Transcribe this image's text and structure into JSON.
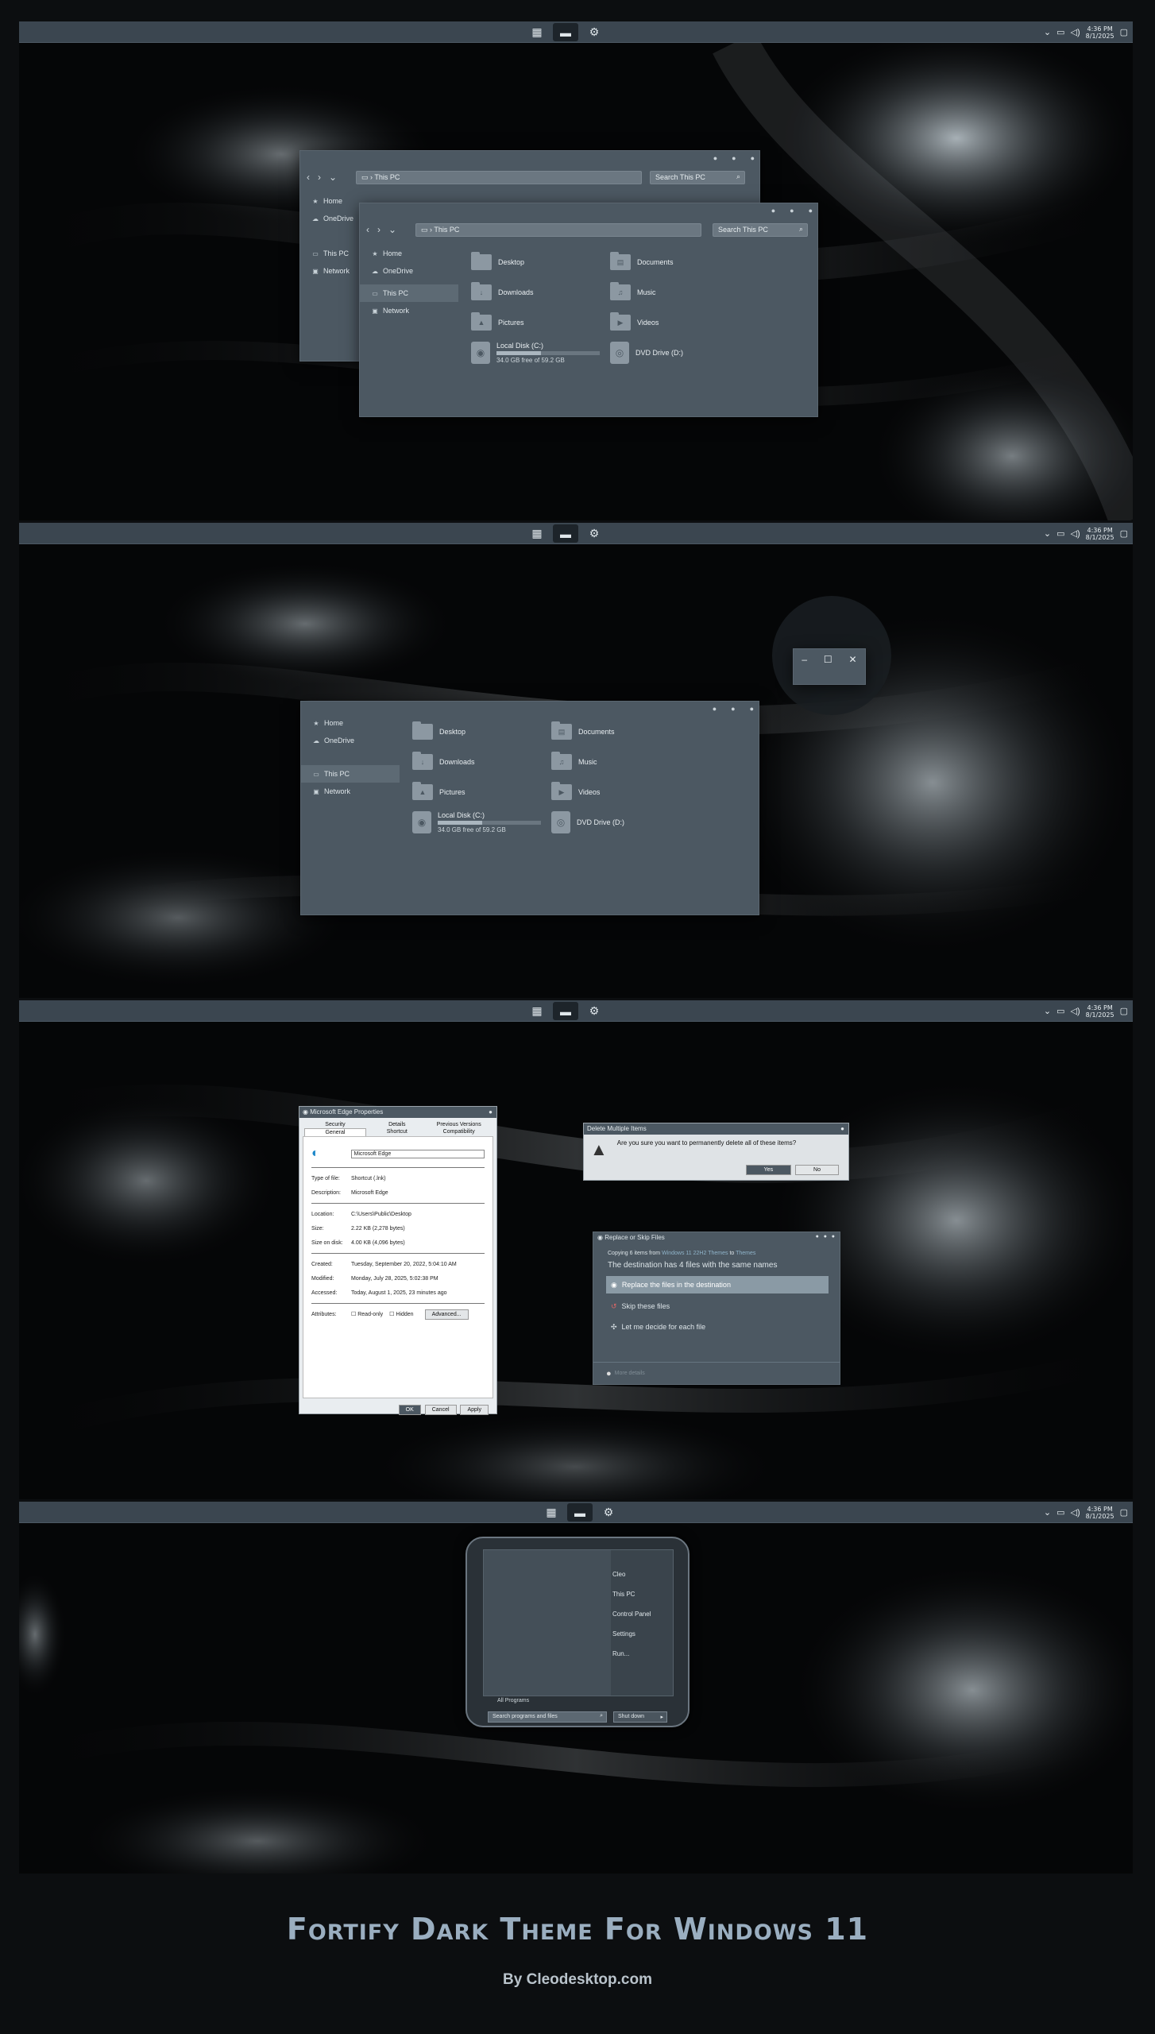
{
  "taskbar": {
    "clock_time": "4:36 PM",
    "clock_date": "8/1/2025",
    "start_icon": "start-grid-icon",
    "explorer_icon": "folder-icon",
    "settings_icon": "settings-icon"
  },
  "explorer": {
    "address": "This PC",
    "search_placeholder": "Search This PC",
    "sidebar": [
      "Home",
      "OneDrive",
      "This PC",
      "Network"
    ],
    "folders": [
      "Desktop",
      "Documents",
      "Downloads",
      "Music",
      "Pictures",
      "Videos"
    ],
    "local_disk": {
      "name": "Local Disk (C:)",
      "free": "34.0 GB free of 59.2 GB",
      "used_fraction": 0.43
    },
    "dvd": "DVD Drive (D:)"
  },
  "properties": {
    "title": "Microsoft Edge Properties",
    "tabs": [
      "Security",
      "Details",
      "Previous Versions",
      "General",
      "Shortcut",
      "Compatibility"
    ],
    "name": "Microsoft Edge",
    "rows": [
      {
        "k": "Type of file:",
        "v": "Shortcut (.lnk)"
      },
      {
        "k": "Description:",
        "v": "Microsoft Edge"
      },
      {
        "k": "Location:",
        "v": "C:\\Users\\Public\\Desktop"
      },
      {
        "k": "Size:",
        "v": "2.22 KB (2,278 bytes)"
      },
      {
        "k": "Size on disk:",
        "v": "4.00 KB (4,096 bytes)"
      },
      {
        "k": "Created:",
        "v": "Tuesday, September 20, 2022, 5:04:10 AM"
      },
      {
        "k": "Modified:",
        "v": "Monday, July 28, 2025, 5:02:38 PM"
      },
      {
        "k": "Accessed:",
        "v": "Today, August 1, 2025, 23 minutes ago"
      }
    ],
    "attributes_label": "Attributes:",
    "readonly": "Read-only",
    "hidden": "Hidden",
    "advanced": "Advanced...",
    "ok": "OK",
    "cancel": "Cancel",
    "apply": "Apply"
  },
  "delete_dialog": {
    "title": "Delete Multiple Items",
    "message": "Are you sure you want to permanently delete all of these items?",
    "yes": "Yes",
    "no": "No"
  },
  "replace_dialog": {
    "title": "Replace or Skip Files",
    "copying_pre": "Copying 6 items from",
    "copying_src": "Windows 11 22H2 Themes",
    "copying_mid": "to",
    "copying_dst": "Themes",
    "heading": "The destination has 4 files with the same names",
    "options": [
      "Replace the files in the destination",
      "Skip these files",
      "Let me decide for each file"
    ],
    "more": "More details"
  },
  "start_menu": {
    "links": [
      "Cleo",
      "This PC",
      "Control Panel",
      "Settings",
      "Run..."
    ],
    "all_programs": "All Programs",
    "search_placeholder": "Search programs and files",
    "shutdown": "Shut down"
  },
  "caption": {
    "title": "Fortify Dark Theme For Windows 11",
    "subtitle": "By Cleodesktop.com"
  }
}
